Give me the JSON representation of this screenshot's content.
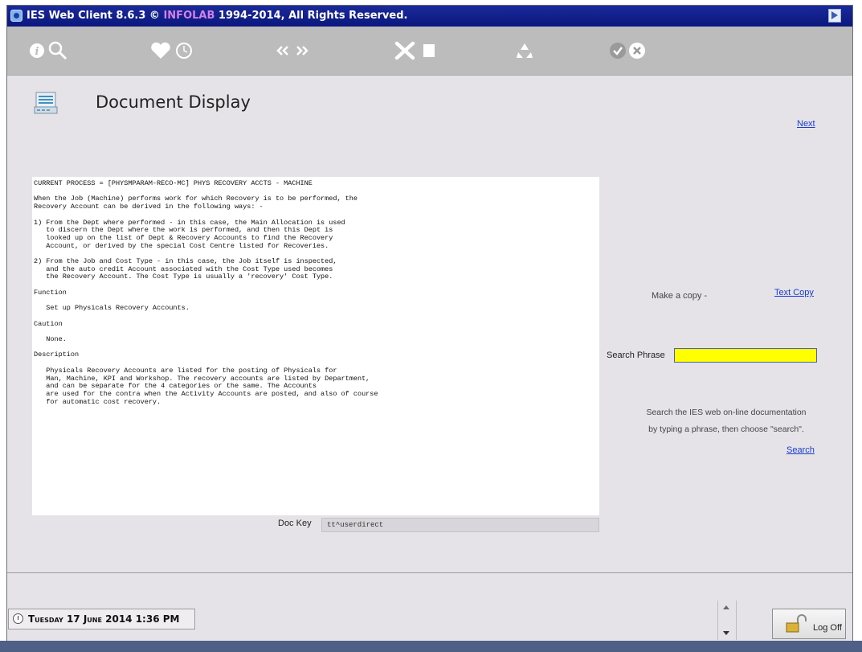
{
  "window": {
    "title_prefix": "IES Web Client 8.6.3 © ",
    "title_brand": "INFOLAB",
    "title_suffix": " 1994-2014, All Rights Reserved."
  },
  "toolbar": {
    "icons": [
      "info-icon",
      "search-icon",
      "heart-icon",
      "clock-icon",
      "previous-icon",
      "next-icon",
      "tools-icon",
      "stop-icon",
      "recycle-icon",
      "accept-icon",
      "cancel-icon"
    ]
  },
  "page": {
    "title": "Document Display",
    "next_link": "Next"
  },
  "document": {
    "text": "CURRENT PROCESS = [PHYSMPARAM-RECO-MC] PHYS RECOVERY ACCTS - MACHINE\n\nWhen the Job (Machine) performs work for which Recovery is to be performed, the\nRecovery Account can be derived in the following ways: -\n\n1) From the Dept where performed - in this case, the Main Allocation is used\n   to discern the Dept where the work is performed, and then this Dept is\n   looked up on the list of Dept & Recovery Accounts to find the Recovery\n   Account, or derived by the special Cost Centre listed for Recoveries.\n\n2) From the Job and Cost Type - in this case, the Job itself is inspected,\n   and the auto credit Account associated with the Cost Type used becomes\n   the Recovery Account. The Cost Type is usually a 'recovery' Cost Type.\n\nFunction\n\n   Set up Physicals Recovery Accounts.\n\nCaution\n\n   None.\n\nDescription\n\n   Physicals Recovery Accounts are listed for the posting of Physicals for\n   Man, Machine, KPI and Workshop. The recovery accounts are listed by Department,\n   and can be separate for the 4 categories or the same. The Accounts\n   are used for the contra when the Activity Accounts are posted, and also of course\n   for automatic cost recovery.",
    "doc_key_label": "Doc Key",
    "doc_key_value": "tt^userdirect"
  },
  "side": {
    "copy_label": "Make a copy -",
    "copy_link": "Text Copy",
    "search_label": "Search Phrase",
    "search_value": "",
    "help_line1": "Search the IES web on-line documentation",
    "help_line2": "by typing a phrase, then choose \"search\".",
    "search_link": "Search"
  },
  "footer": {
    "date": "Tuesday 17 June 2014 1:36 PM",
    "logoff": "Log Off"
  },
  "colors": {
    "titlebar": "#0b177e",
    "search_field": "#ffff00",
    "link": "#1a3ccc"
  }
}
